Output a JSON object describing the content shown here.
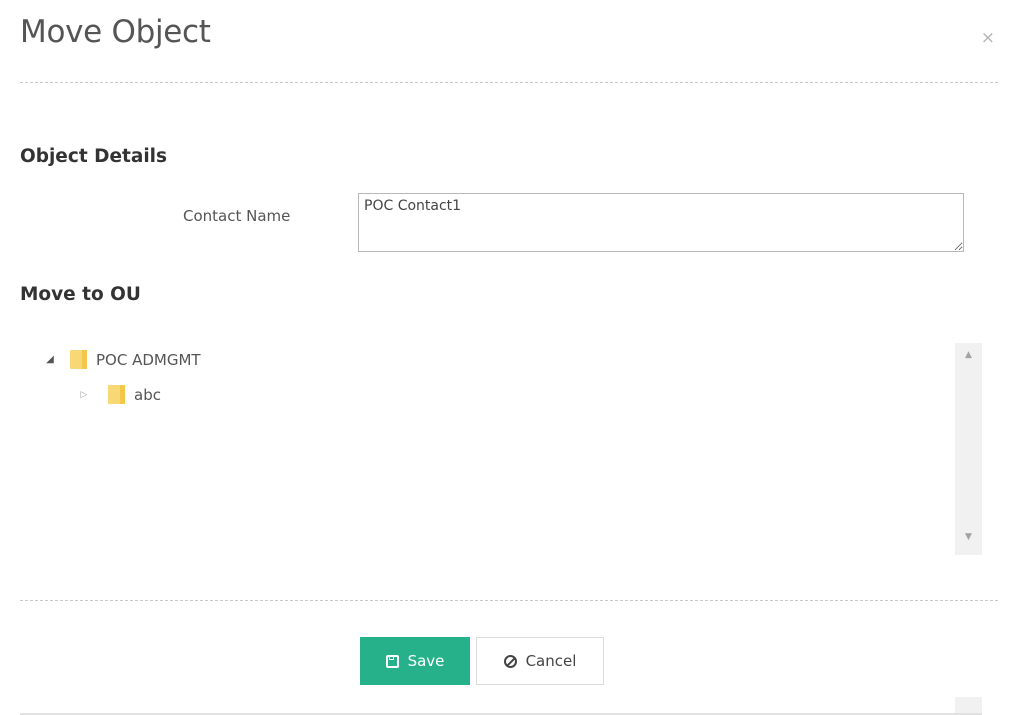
{
  "dialog": {
    "title": "Move Object",
    "close_symbol": "×"
  },
  "object_details": {
    "heading": "Object Details",
    "contact_name_label": "Contact Name",
    "contact_name_value": "POC Contact1"
  },
  "move_to_ou": {
    "heading": "Move to OU",
    "tree": [
      {
        "label": "POC ADMGMT",
        "expanded": true,
        "icon": "folder-icon",
        "level": 0
      },
      {
        "label": "abc",
        "expanded": false,
        "icon": "folder-icon",
        "level": 1
      }
    ]
  },
  "footer": {
    "save_label": "Save",
    "cancel_label": "Cancel"
  },
  "colors": {
    "accent": "#26b18b",
    "folder": "#f8d775"
  }
}
